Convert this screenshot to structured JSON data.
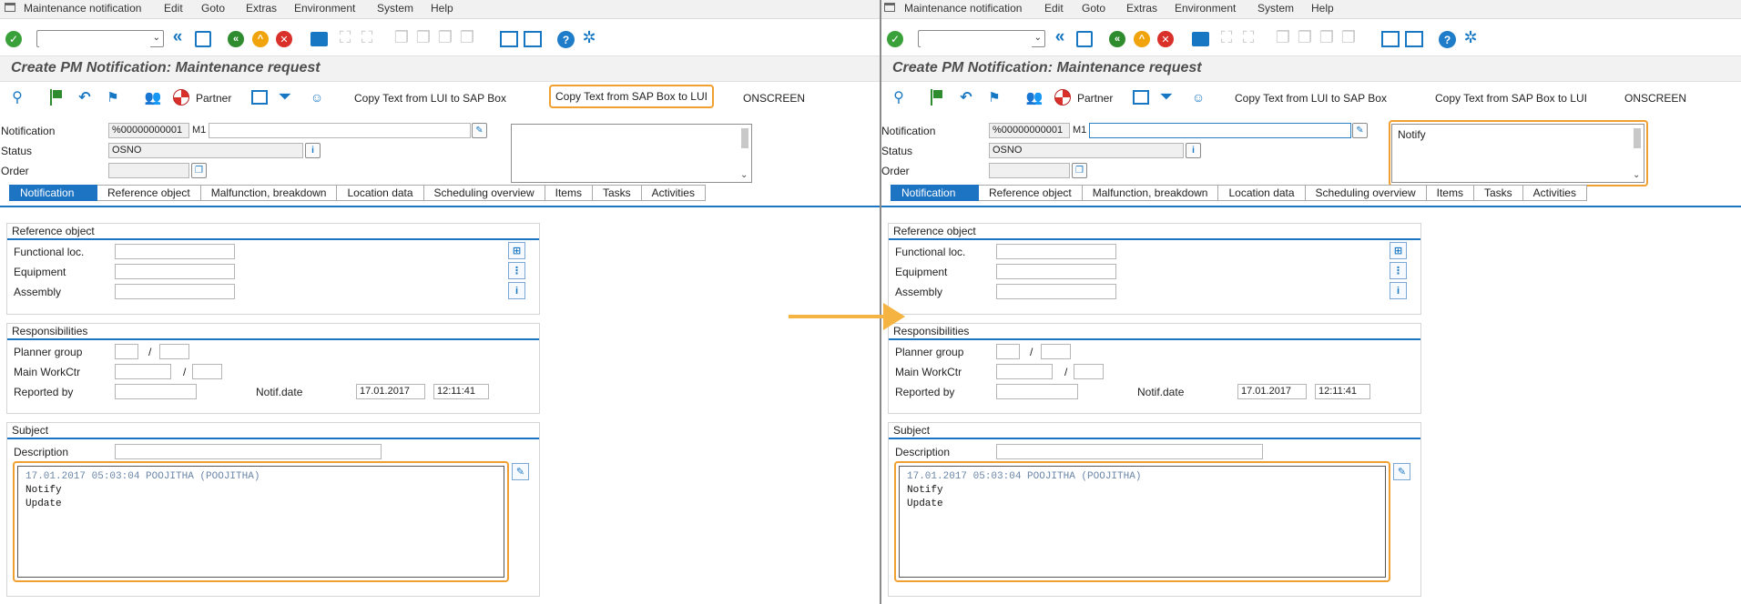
{
  "menu": [
    "Maintenance notification",
    "Edit",
    "Goto",
    "Extras",
    "Environment",
    "System",
    "Help"
  ],
  "title": "Create PM Notification: Maintenance request",
  "app_toolbar": {
    "partner": "Partner",
    "copy_lui_to_sap": "Copy Text from LUI to SAP Box",
    "copy_sap_to_lui": "Copy Text from SAP Box to LUI",
    "onscreen": "ONSCREEN"
  },
  "header": {
    "notification_label": "Notification",
    "notification_value": "%00000000001",
    "notification_type": "M1",
    "status_label": "Status",
    "status_value": "OSNO",
    "order_label": "Order",
    "info_icon_text": "i"
  },
  "tabs": [
    "Notification",
    "Reference object",
    "Malfunction, breakdown",
    "Location data",
    "Scheduling overview",
    "Items",
    "Tasks",
    "Activities"
  ],
  "groups": {
    "reference_object": {
      "title": "Reference object",
      "functional_loc": "Functional loc.",
      "equipment": "Equipment",
      "assembly": "Assembly"
    },
    "responsibilities": {
      "title": "Responsibilities",
      "planner_group": "Planner group",
      "main_workctr": "Main WorkCtr",
      "reported_by": "Reported by",
      "notif_date_label": "Notif.date",
      "notif_date": "17.01.2017",
      "notif_time": "12:11:41",
      "slash": "/"
    },
    "subject": {
      "title": "Subject",
      "description": "Description"
    }
  },
  "longtext": {
    "line1": "17.01.2017 05:03:04  POOJITHA (POOJITHA)",
    "line2": "Notify",
    "line3": "Update"
  },
  "lui_text_after": "Notify",
  "colors": {
    "accent": "#1d74c3",
    "highlight": "#f0a030",
    "arrow": "#f5b342"
  }
}
